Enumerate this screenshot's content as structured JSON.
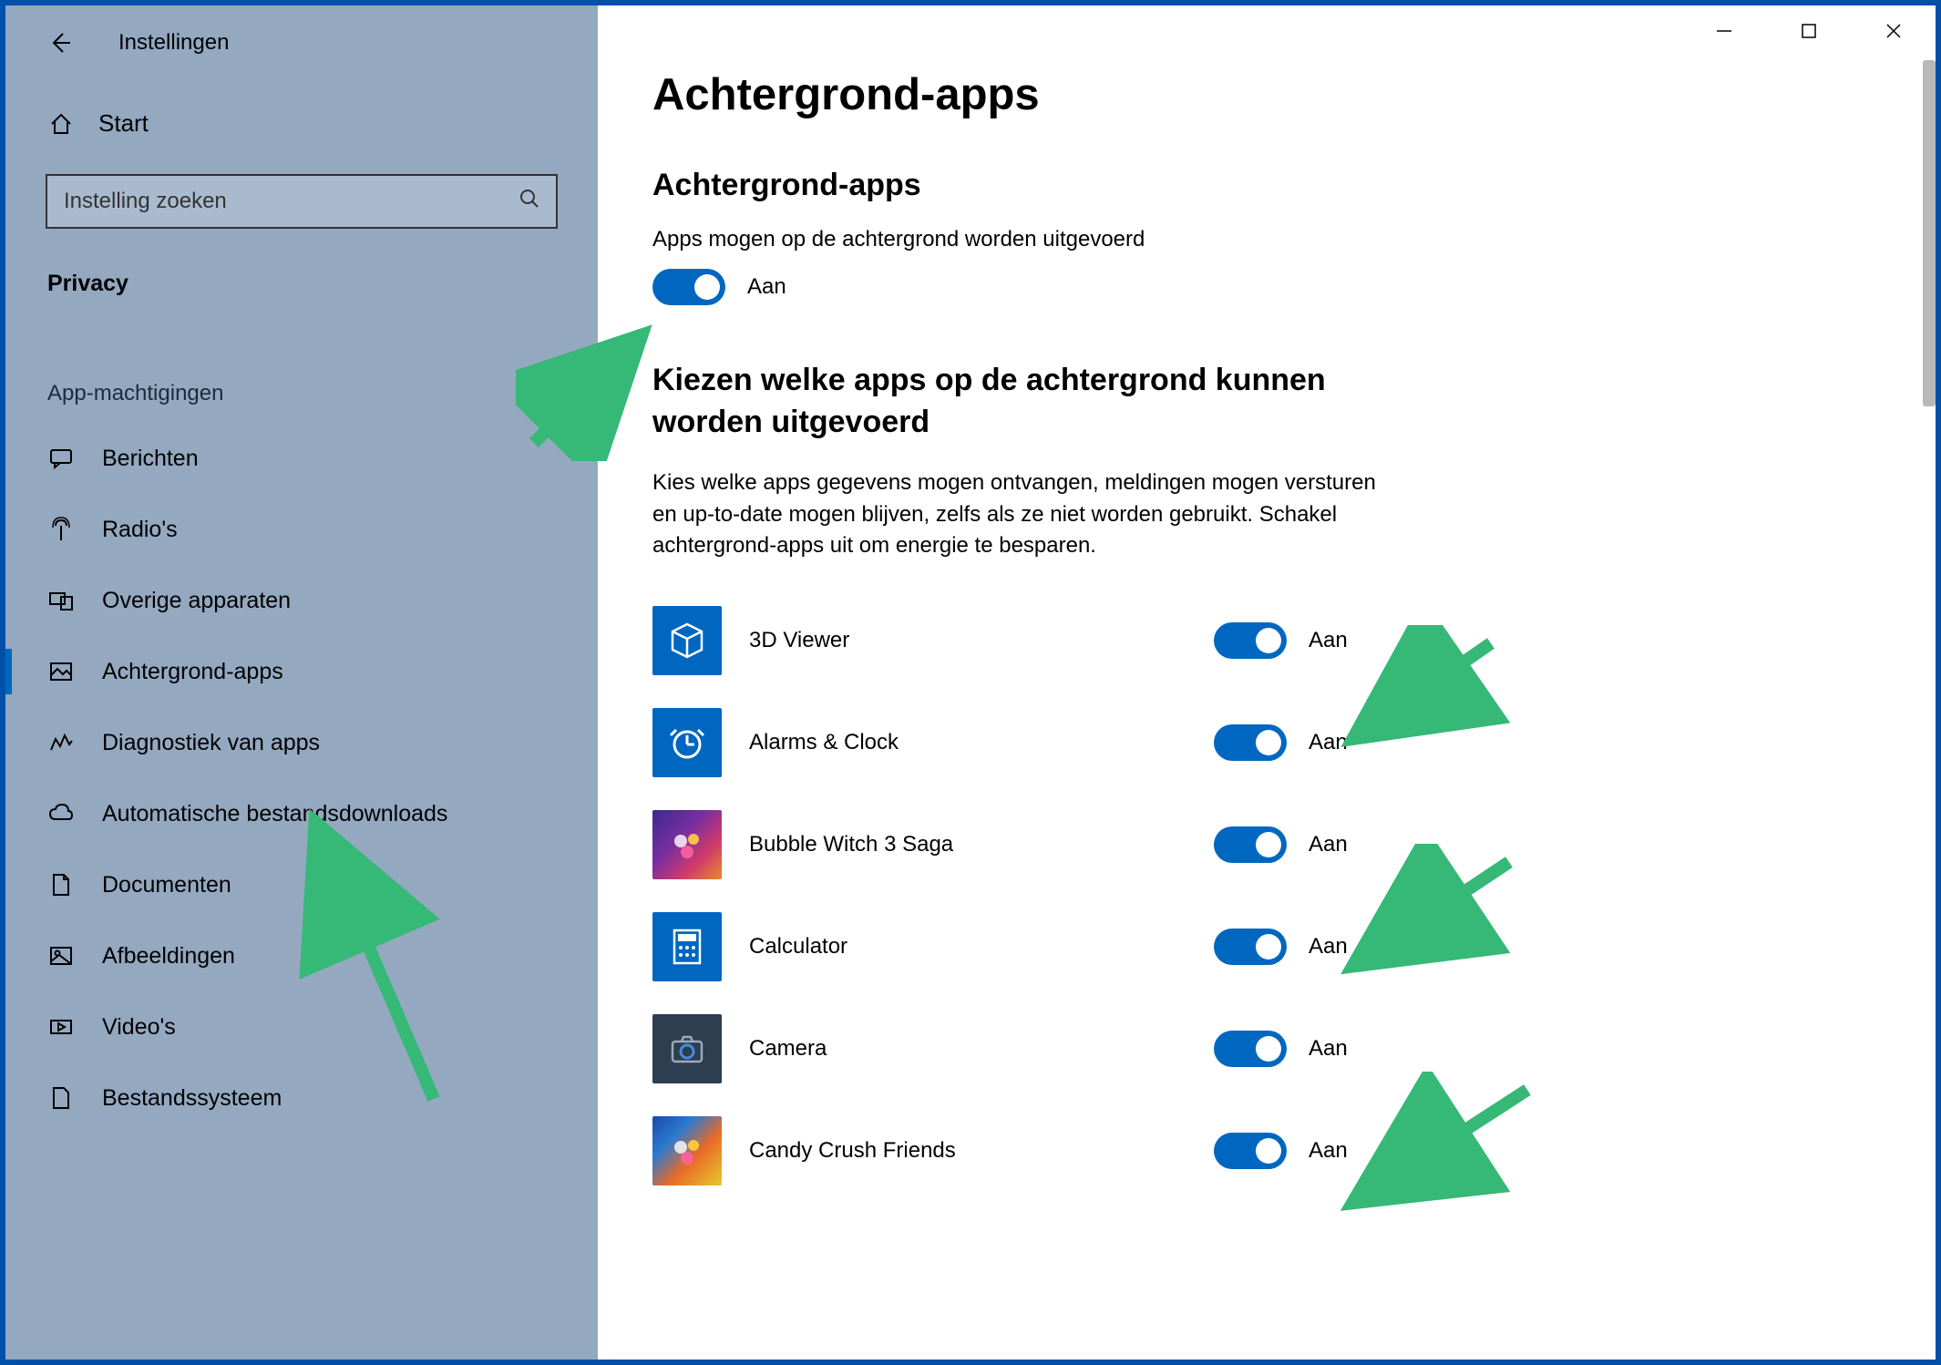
{
  "window": {
    "title": "Instellingen",
    "home_label": "Start",
    "search_placeholder": "Instelling zoeken",
    "category": "Privacy",
    "section_label": "App-machtigingen"
  },
  "sidebar": {
    "items": [
      {
        "id": "berichten",
        "label": "Berichten"
      },
      {
        "id": "radios",
        "label": "Radio's"
      },
      {
        "id": "overige",
        "label": "Overige apparaten"
      },
      {
        "id": "achtergrond",
        "label": "Achtergrond-apps"
      },
      {
        "id": "diagnostiek",
        "label": "Diagnostiek van apps"
      },
      {
        "id": "autodl",
        "label": "Automatische bestandsdownloads"
      },
      {
        "id": "documenten",
        "label": "Documenten"
      },
      {
        "id": "afbeeldingen",
        "label": "Afbeeldingen"
      },
      {
        "id": "videos",
        "label": "Video's"
      },
      {
        "id": "bestand",
        "label": "Bestandssysteem"
      }
    ]
  },
  "main": {
    "page_title": "Achtergrond-apps",
    "section1_title": "Achtergrond-apps",
    "section1_desc": "Apps mogen op de achtergrond worden uitgevoerd",
    "master_toggle": {
      "state": "on",
      "label": "Aan"
    },
    "section2_title": "Kiezen welke apps op de achtergrond kunnen worden uitgevoerd",
    "section2_desc": "Kies welke apps gegevens mogen ontvangen, meldingen mogen versturen en up-to-date mogen blijven, zelfs als ze niet worden gebruikt. Schakel achtergrond-apps uit om energie te besparen.",
    "apps": [
      {
        "name": "3D Viewer",
        "toggle": "Aan",
        "iconcls": "blue",
        "iconname": "cube-icon"
      },
      {
        "name": "Alarms & Clock",
        "toggle": "Aan",
        "iconcls": "blue",
        "iconname": "alarm-icon"
      },
      {
        "name": "Bubble Witch 3 Saga",
        "toggle": "Aan",
        "iconcls": "mix",
        "iconname": "game-icon"
      },
      {
        "name": "Calculator",
        "toggle": "Aan",
        "iconcls": "blue",
        "iconname": "calculator-icon"
      },
      {
        "name": "Camera",
        "toggle": "Aan",
        "iconcls": "dark",
        "iconname": "camera-icon"
      },
      {
        "name": "Candy Crush Friends",
        "toggle": "Aan",
        "iconcls": "crush",
        "iconname": "game-icon"
      }
    ]
  },
  "annotation_color": "#36b877"
}
